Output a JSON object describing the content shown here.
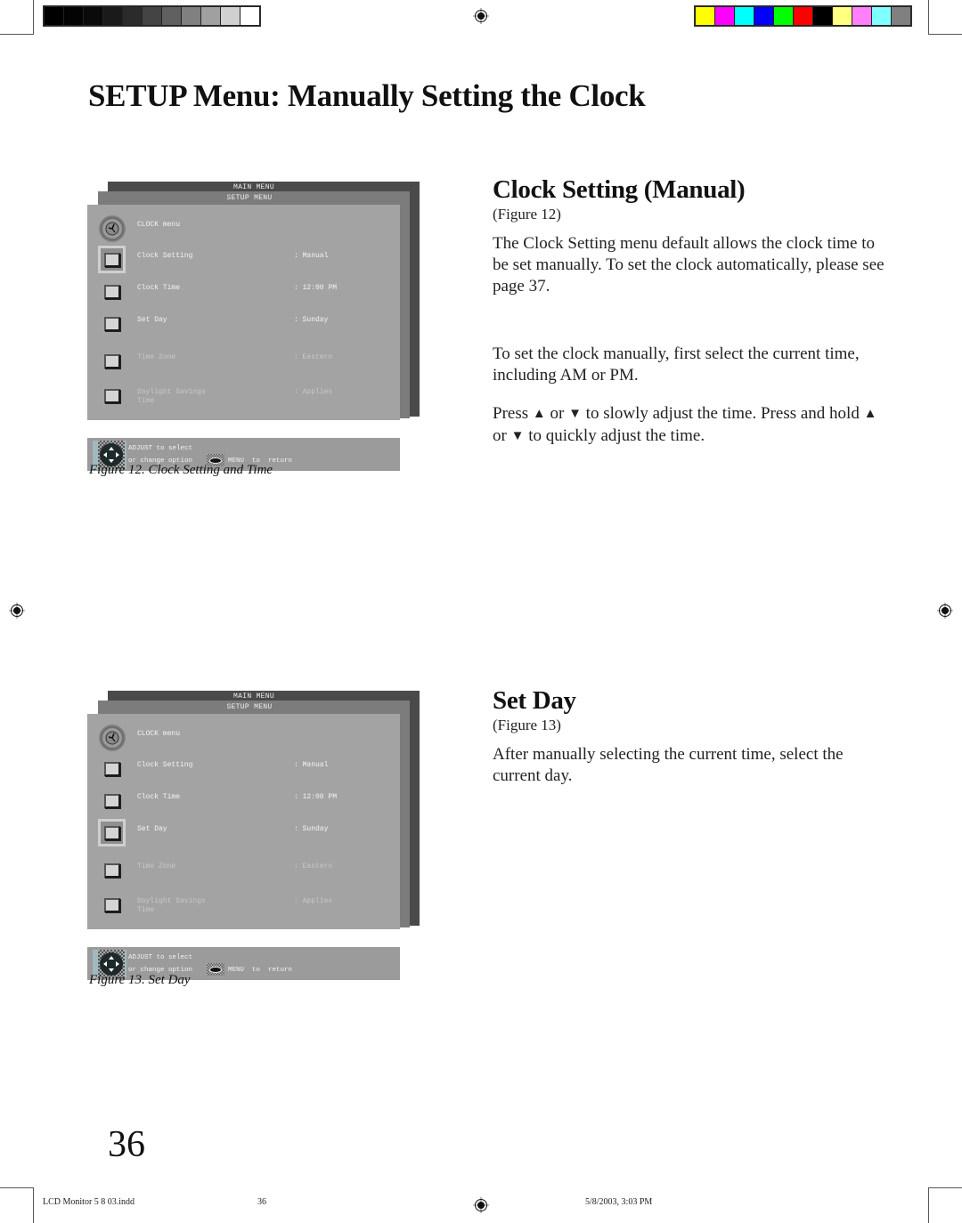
{
  "color_bars": {
    "grayscale": [
      "#000000",
      "#030303",
      "#0a0a0a",
      "#1a1a1a",
      "#2b2b2b",
      "#444444",
      "#606060",
      "#808080",
      "#a0a0a0",
      "#d0d0d0",
      "#ffffff"
    ],
    "color": [
      "#ffff00",
      "#ff00ff",
      "#00ffff",
      "#0000ff",
      "#00ff00",
      "#ff0000",
      "#000000",
      "#ffff80",
      "#ff80ff",
      "#80ffff",
      "#808080"
    ]
  },
  "page_title": "SETUP Menu: Manually Setting the Clock",
  "sections": [
    {
      "title": "Clock Setting (Manual)",
      "figure_ref": "(Figure 12)",
      "paragraphs": [
        "The Clock Setting menu default allows the clock time to be set manually.  To set the clock automatically, please see page 37.",
        "To set the clock manually, first select the current time, including AM or PM."
      ],
      "press": {
        "w1": "Press",
        "up": "▲",
        "or": "or",
        "down": "▼",
        "w2": "to slowly adjust the time.  Press and hold",
        "w3": "to quickly adjust the time."
      }
    },
    {
      "title": "Set Day",
      "figure_ref": "(Figure 13)",
      "paragraphs": [
        "After manually selecting the current time, select the current day."
      ]
    }
  ],
  "osd_figures": [
    {
      "main_menu": "MAIN MENU",
      "setup_menu": "SETUP MENU",
      "header": "CLOCK menu",
      "selected_row": "Clock Setting",
      "rows": [
        {
          "label": "Clock Setting",
          "value": ": Manual"
        },
        {
          "label": "Clock Time",
          "value": ": 12:00 PM"
        },
        {
          "label": "Set Day",
          "value": ": Sunday"
        },
        {
          "label": "Time Zone",
          "value": ": Eastern"
        },
        {
          "label": "Daylight Savings\nTime",
          "value": ": Applies"
        }
      ],
      "help_line1": "ADJUST to select",
      "help_line2": "or change option",
      "help_line3": "MENU  to  return",
      "caption": "Figure 12.  Clock Setting and Time"
    },
    {
      "main_menu": "MAIN MENU",
      "setup_menu": "SETUP MENU",
      "header": "CLOCK menu",
      "selected_row": "Set Day",
      "rows": [
        {
          "label": "Clock Setting",
          "value": ": Manual"
        },
        {
          "label": "Clock Time",
          "value": ": 12:00 PM"
        },
        {
          "label": "Set Day",
          "value": ": Sunday"
        },
        {
          "label": "Time Zone",
          "value": ": Eastern"
        },
        {
          "label": "Daylight Savings\nTime",
          "value": ": Applies"
        }
      ],
      "help_line1": "ADJUST to select",
      "help_line2": "or change option",
      "help_line3": "MENU  to  return",
      "caption": "Figure 13.  Set Day"
    }
  ],
  "page_number": "36",
  "footer": {
    "file": "LCD Monitor 5 8 03.indd",
    "page": "36",
    "timestamp": "5/8/2003, 3:03 PM"
  }
}
